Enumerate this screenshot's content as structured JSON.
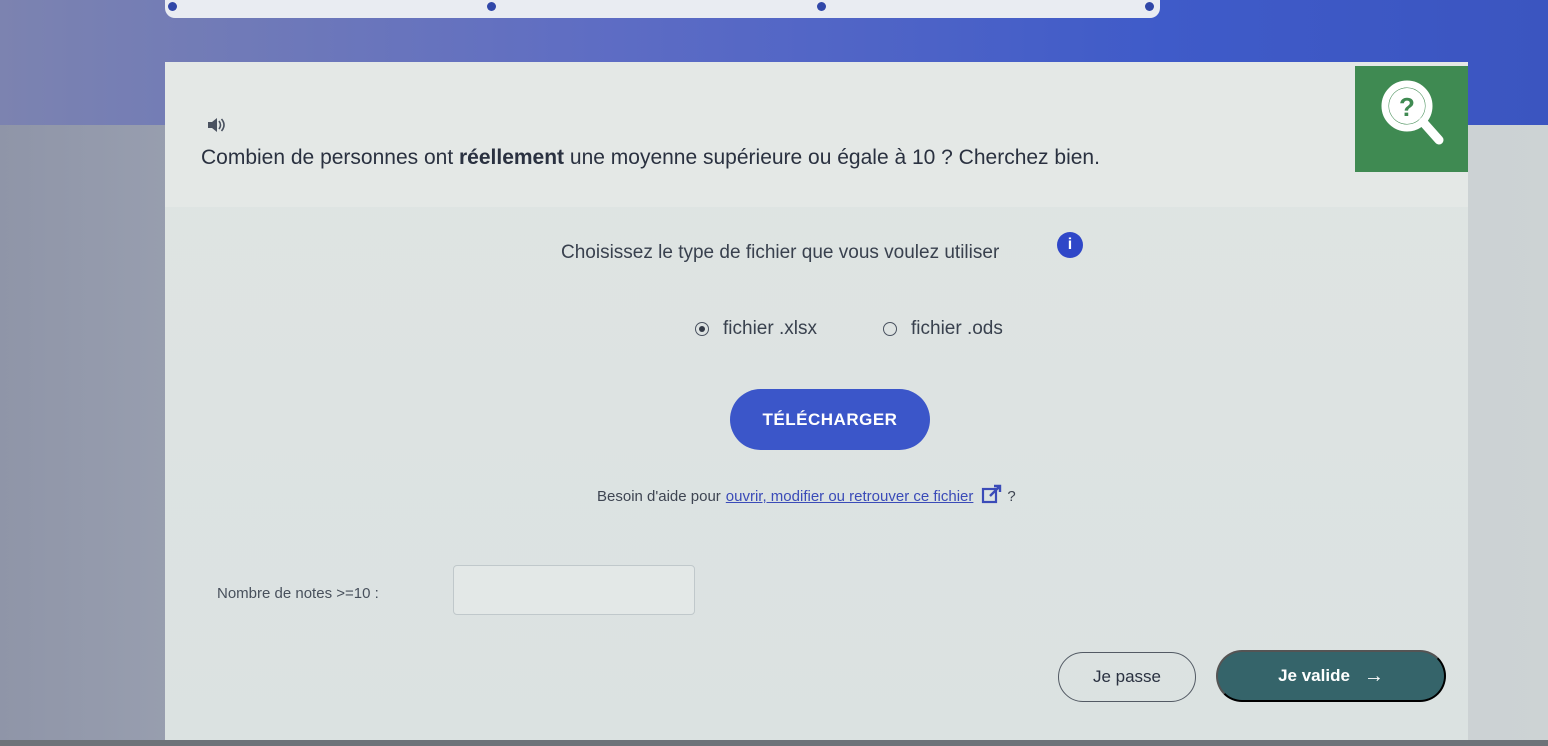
{
  "progress": {
    "dots": 4
  },
  "question": {
    "text_before": "Combien de personnes ont ",
    "text_bold": "réellement",
    "text_after": " une moyenne supérieure ou égale à 10 ? Cherchez bien."
  },
  "help_badge": {
    "icon": "question-magnifier-icon",
    "color": "#3f8a52"
  },
  "file_choice": {
    "prompt": "Choisissez le type de fichier que vous voulez utiliser",
    "info_glyph": "i",
    "options": [
      {
        "label": "fichier .xlsx",
        "selected": true
      },
      {
        "label": "fichier .ods",
        "selected": false
      }
    ]
  },
  "download": {
    "label": "TÉLÉCHARGER",
    "color": "#3b56c9"
  },
  "help_line": {
    "prefix": "Besoin d'aide pour",
    "link": "ouvrir, modifier ou retrouver ce fichier",
    "suffix": "?"
  },
  "answer": {
    "label": "Nombre de notes >=10 :",
    "value": ""
  },
  "actions": {
    "skip_label": "Je passe",
    "validate_label": "Je valide",
    "validate_arrow": "→",
    "validate_color": "#35646a"
  }
}
